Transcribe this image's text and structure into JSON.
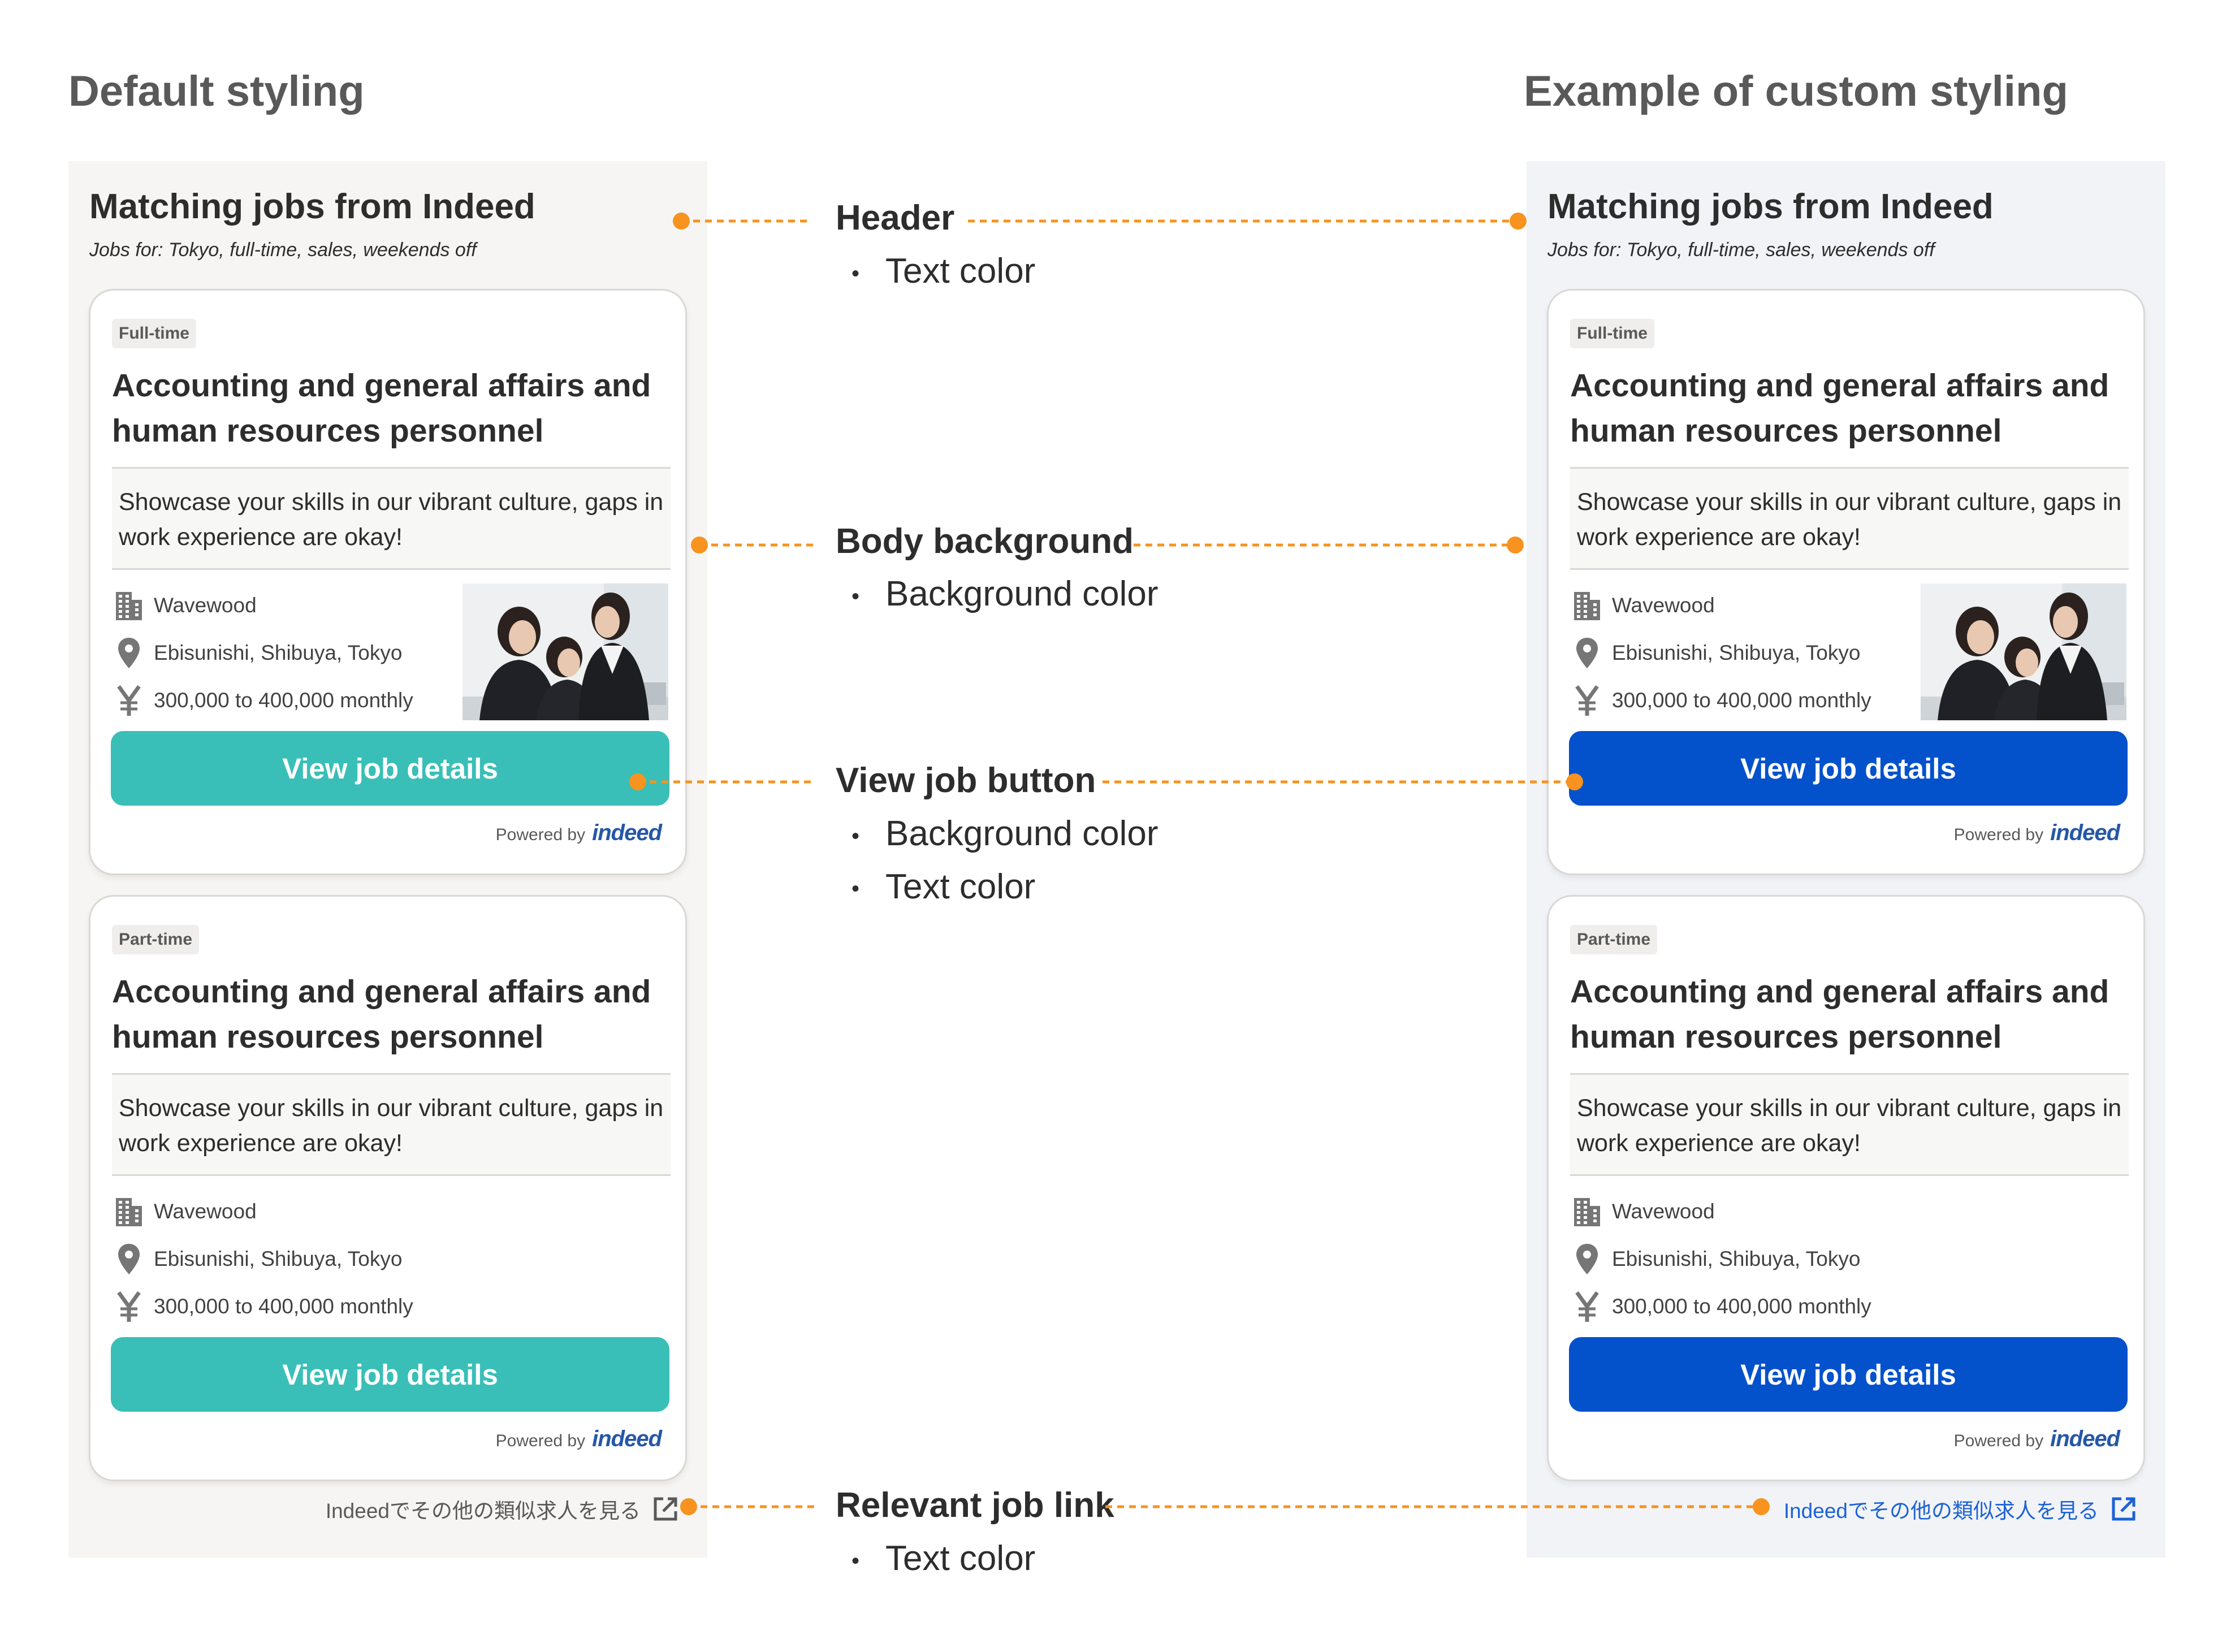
{
  "sections": {
    "default_title": "Default styling",
    "custom_title": "Example of custom styling"
  },
  "widget": {
    "title": "Matching jobs from Indeed",
    "subtitle": "Jobs for: Tokyo, full-time, sales, weekends off",
    "jobs": [
      {
        "badge": "Full-time",
        "title": "Accounting and general affairs and human resources personnel",
        "snippet": "Showcase your skills in our vibrant culture, gaps in work experience are okay!",
        "company": "Wavewood",
        "location": "Ebisunishi, Shibuya, Tokyo",
        "salary": "300,000 to 400,000 monthly",
        "has_photo": true,
        "button": "View job details"
      },
      {
        "badge": "Part-time",
        "title": "Accounting and general affairs and human resources personnel",
        "snippet": "Showcase your skills in our vibrant culture, gaps in work experience are okay!",
        "company": "Wavewood",
        "location": "Ebisunishi, Shibuya, Tokyo",
        "salary": "300,000 to 400,000 monthly",
        "has_photo": false,
        "button": "View job details"
      }
    ],
    "powered_by": "Powered by",
    "brand_logo": "indeed",
    "relevant_link": "Indeedでその他の類似求人を見る"
  },
  "icons": {
    "company": "building-icon",
    "location": "map-pin-icon",
    "salary": "yen-icon",
    "external": "external-link-icon"
  },
  "themes": {
    "default": {
      "panel_bg": "#f6f5f3",
      "button_bg": "#39bfb7",
      "button_text": "#ffffff",
      "link_color": "#595959"
    },
    "custom": {
      "panel_bg": "#f2f3f7",
      "button_bg": "#0451cc",
      "button_text": "#ffffff",
      "link_color": "#1b62d6"
    }
  },
  "callouts": [
    {
      "title": "Header",
      "bullets": [
        "Text color"
      ]
    },
    {
      "title": "Body background",
      "bullets": [
        "Background color"
      ]
    },
    {
      "title": "View job button",
      "bullets": [
        "Background color",
        "Text color"
      ]
    },
    {
      "title": "Relevant job link",
      "bullets": [
        "Text color"
      ]
    }
  ],
  "annotation_color": "#f7931e"
}
